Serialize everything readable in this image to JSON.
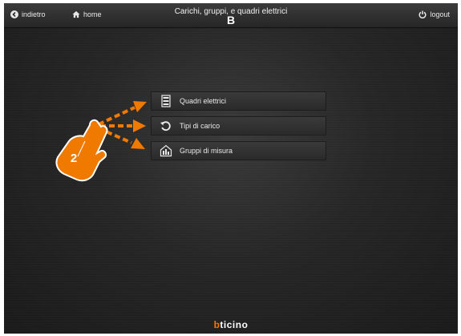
{
  "header": {
    "back_label": "indietro",
    "home_label": "home",
    "title": "Carichi, gruppi, e quadri elettrici",
    "marker": "B",
    "logout_label": "logout"
  },
  "menu": {
    "items": [
      {
        "label": "Quadri elettrici",
        "icon": "electrical-panel-icon"
      },
      {
        "label": "Tipi di carico",
        "icon": "load-type-icon"
      },
      {
        "label": "Gruppi di misura",
        "icon": "measurement-group-icon"
      }
    ]
  },
  "callout": {
    "step": "2"
  },
  "brand": {
    "first": "b",
    "rest": "ticino"
  },
  "colors": {
    "accent": "#f07a00",
    "background": "#262626",
    "text": "#eaeaea"
  }
}
